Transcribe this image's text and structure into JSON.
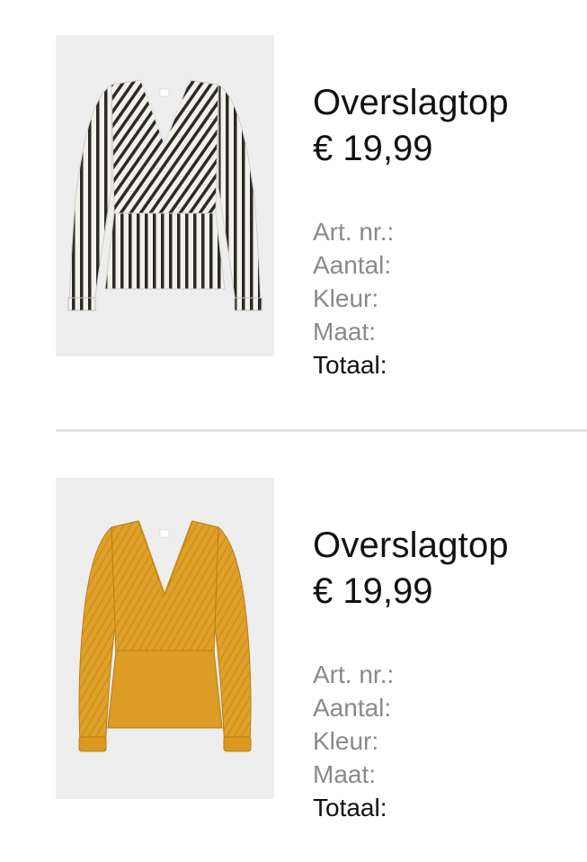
{
  "products": [
    {
      "name": "Overslagtop",
      "price": "€ 19,99",
      "image": {
        "icon": "striped-wrap-top-photo",
        "colors": {
          "background": "#eeeeee",
          "base": "#f4f1ea",
          "stripe": "#2a2a2a"
        }
      },
      "details": {
        "art_nr_label": "Art. nr.:",
        "quantity_label": "Aantal:",
        "color_label": "Kleur:",
        "size_label": "Maat:",
        "total_label": "Totaal:"
      }
    },
    {
      "name": "Overslagtop",
      "price": "€ 19,99",
      "image": {
        "icon": "mustard-wrap-top-photo",
        "colors": {
          "background": "#eeeeee",
          "base": "#e0a12a",
          "shade": "#c98a1a"
        }
      },
      "details": {
        "art_nr_label": "Art. nr.:",
        "quantity_label": "Aantal:",
        "color_label": "Kleur:",
        "size_label": "Maat:",
        "total_label": "Totaal:"
      }
    }
  ]
}
